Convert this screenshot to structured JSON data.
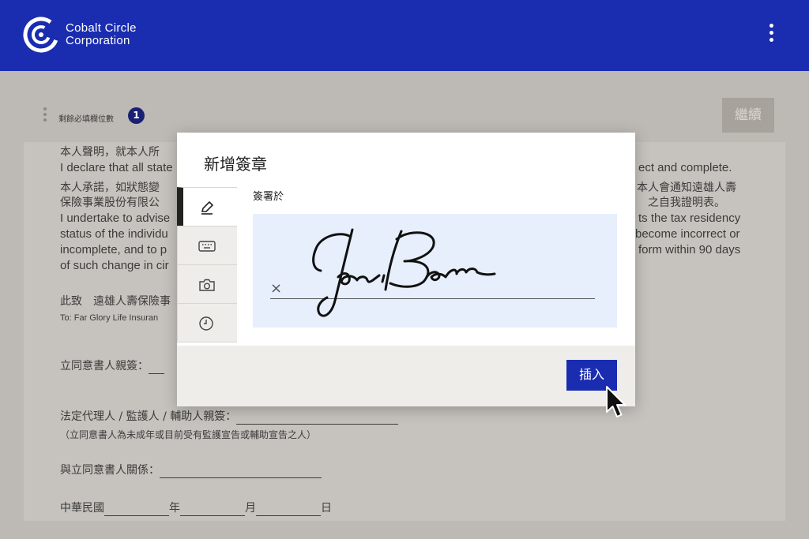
{
  "header": {
    "brand_line1": "Cobalt Circle",
    "brand_line2": "Corporation",
    "menu_icon": "kebab-menu-icon"
  },
  "toolbar": {
    "required_label": "剩餘必填欄位數",
    "required_count": "1",
    "continue_label": "繼續"
  },
  "document": {
    "p1_zh": "本人聲明，就本人所",
    "p1_en_start": "I declare that all state",
    "p1_en_end": "ect and complete.",
    "p2_zh_start_1": "本人承諾，如狀態變",
    "p2_zh_start_2": "保險事業股份有限公",
    "p2_zh_end_1": "本人會通知遠雄人壽",
    "p2_zh_end_2": "之自我證明表。",
    "p2_en_start_1": "I undertake to advise",
    "p2_en_start_2": "status of the individu",
    "p2_en_start_3": "incomplete, and to p",
    "p2_en_start_4": "of such change in cir",
    "p2_en_end_1": "ts the tax residency",
    "p2_en_end_2": "become incorrect or",
    "p2_en_end_3": "form within 90 days",
    "to_zh": "此致　遠雄人壽保險事",
    "to_en": "To: Far Glory Life Insuran",
    "consent_sign": "立同意書人親簽：",
    "guardian_sign": "法定代理人 / 監護人 / 輔助人親簽：",
    "guardian_note": "（立同意書人為未成年或目前受有監護宣告或輔助宣告之人）",
    "relation": "與立同意書人關係：",
    "date_prefix": "中華民國",
    "date_year": "年",
    "date_month": "月",
    "date_day": "日"
  },
  "modal": {
    "title": "新增簽章",
    "sign_label": "簽署於",
    "sign_x": "×",
    "insert_label": "插入",
    "tabs": [
      {
        "icon": "pen-icon",
        "active": true
      },
      {
        "icon": "keyboard-icon",
        "active": false
      },
      {
        "icon": "camera-icon",
        "active": false
      },
      {
        "icon": "clock-icon",
        "active": false
      }
    ]
  },
  "colors": {
    "brand_blue": "#1a2db0",
    "badge_navy": "#1a2173",
    "signature_bg": "#e7effc"
  }
}
